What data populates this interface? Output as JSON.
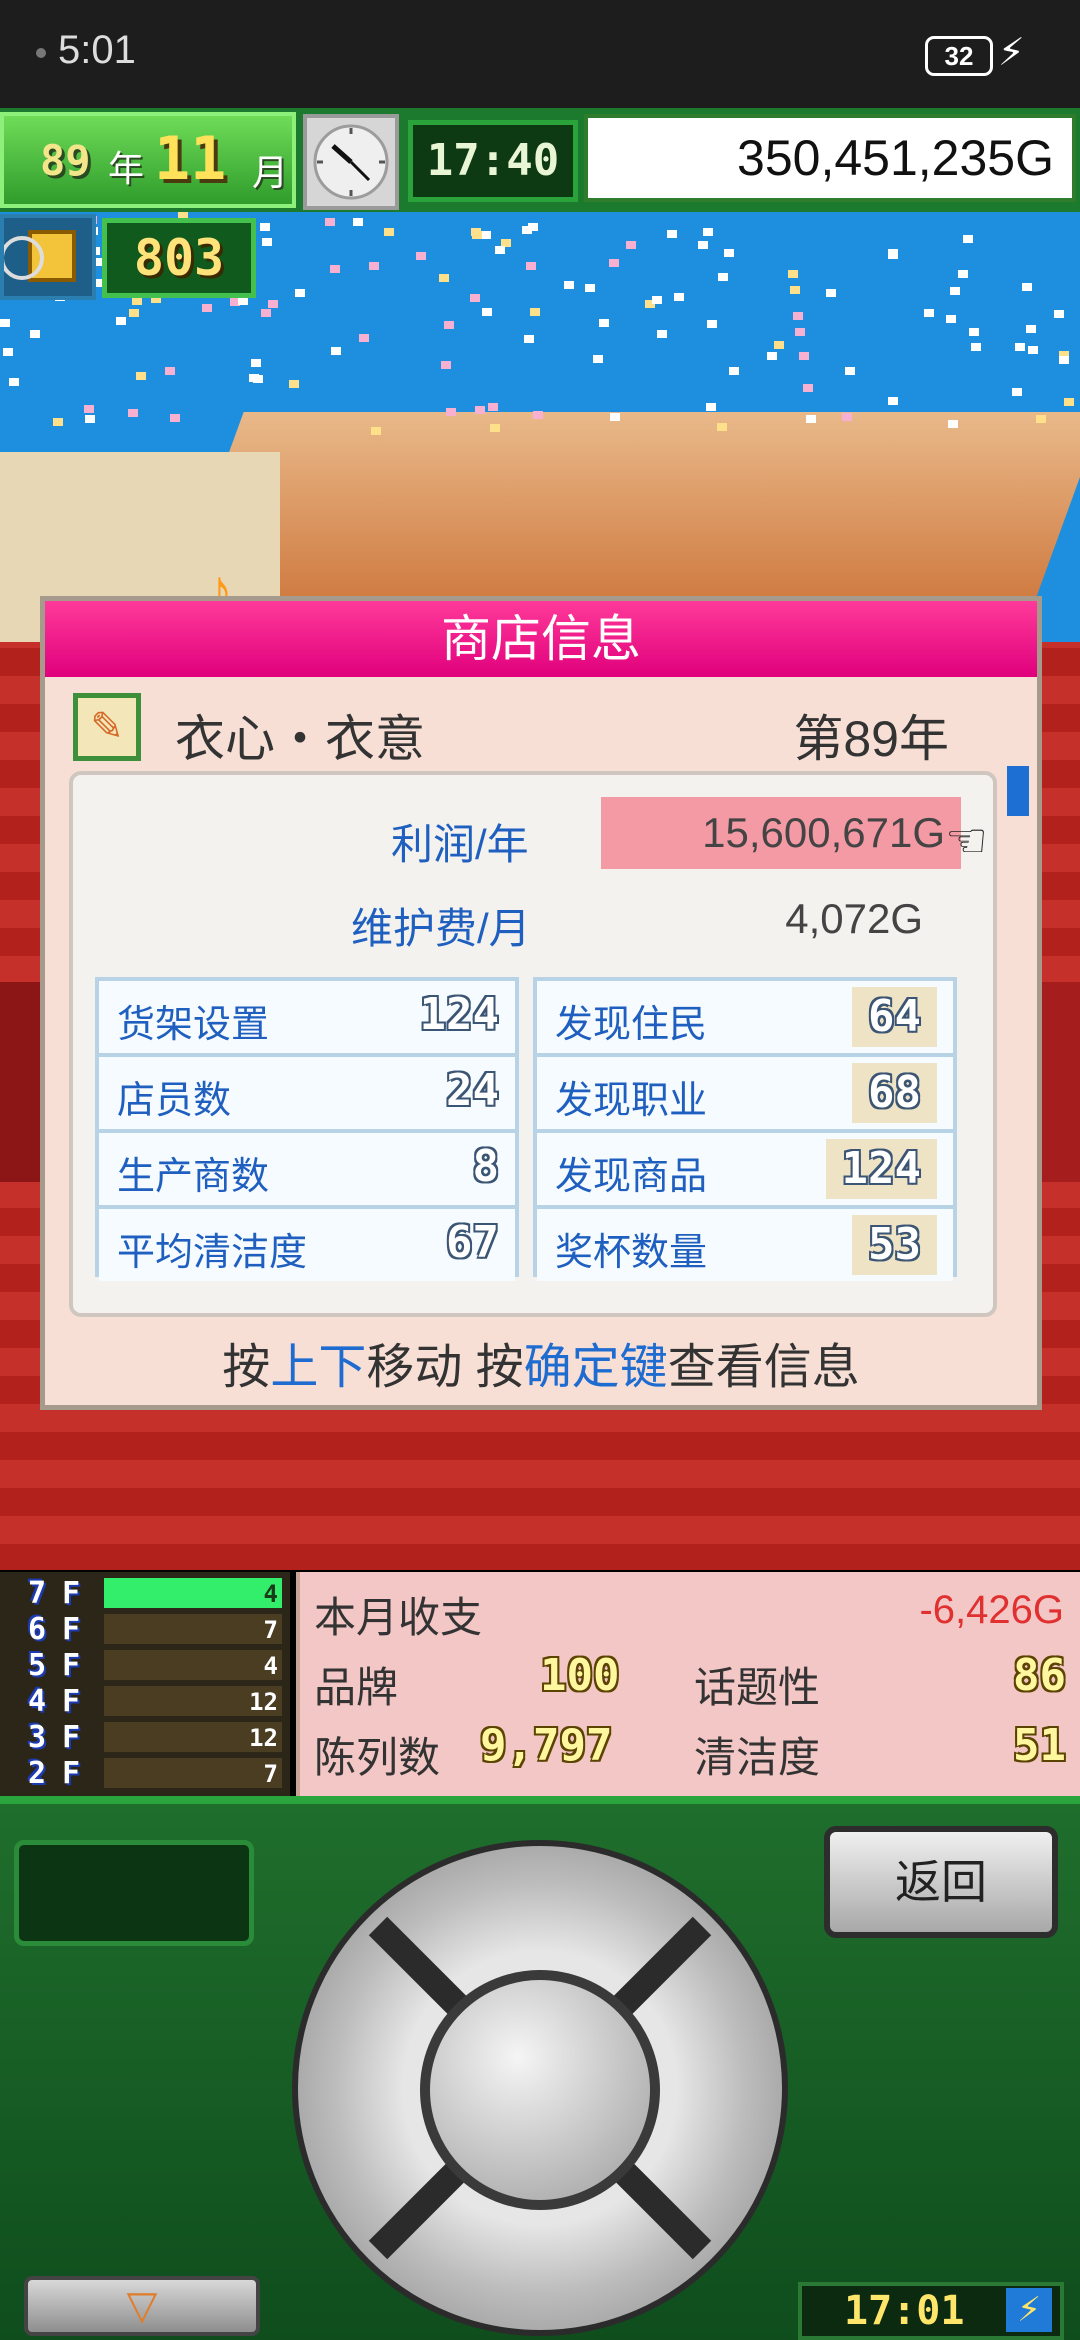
{
  "status_bar": {
    "time": "5:01",
    "battery": "32"
  },
  "hud": {
    "year": "89",
    "year_label": "年",
    "month": "11",
    "month_label": "月",
    "game_time": "17:40",
    "money": "350,451,235G",
    "medals": "803"
  },
  "dialog": {
    "title": "商店信息",
    "shop_name": "衣心・衣意",
    "shop_year": "第89年",
    "profit_label": "利润/年",
    "profit_value": "15,600,671G",
    "maintenance_label": "维护费/月",
    "maintenance_value": "4,072G",
    "left_stats": [
      {
        "label": "货架设置",
        "value": "124"
      },
      {
        "label": "店员数",
        "value": "24"
      },
      {
        "label": "生产商数",
        "value": "8"
      },
      {
        "label": "平均清洁度",
        "value": "67"
      }
    ],
    "right_stats": [
      {
        "label": "发现住民",
        "value": "64"
      },
      {
        "label": "发现职业",
        "value": "68"
      },
      {
        "label": "发现商品",
        "value": "124"
      },
      {
        "label": "奖杯数量",
        "value": "53"
      }
    ],
    "hint": {
      "p1": "按",
      "p2": "上下",
      "p3": "移动 按",
      "p4": "确定键",
      "p5": "查看信息"
    }
  },
  "floors": [
    {
      "num": "7",
      "f": "F",
      "count": "4"
    },
    {
      "num": "6",
      "f": "F",
      "count": "7"
    },
    {
      "num": "5",
      "f": "F",
      "count": "4"
    },
    {
      "num": "4",
      "f": "F",
      "count": "12"
    },
    {
      "num": "3",
      "f": "F",
      "count": "12"
    },
    {
      "num": "2",
      "f": "F",
      "count": "7"
    }
  ],
  "info": {
    "month_label": "本月收支",
    "month_value": "-6,426G",
    "brand_label": "品牌",
    "brand_value": "100",
    "topic_label": "话题性",
    "topic_value": "86",
    "display_label": "陈列数",
    "display_value": "9,797",
    "clean_label": "清洁度",
    "clean_value": "51"
  },
  "controller": {
    "back_label": "返回",
    "down_arrow": "▽",
    "clock": "17:01",
    "bolt": "⚡"
  }
}
